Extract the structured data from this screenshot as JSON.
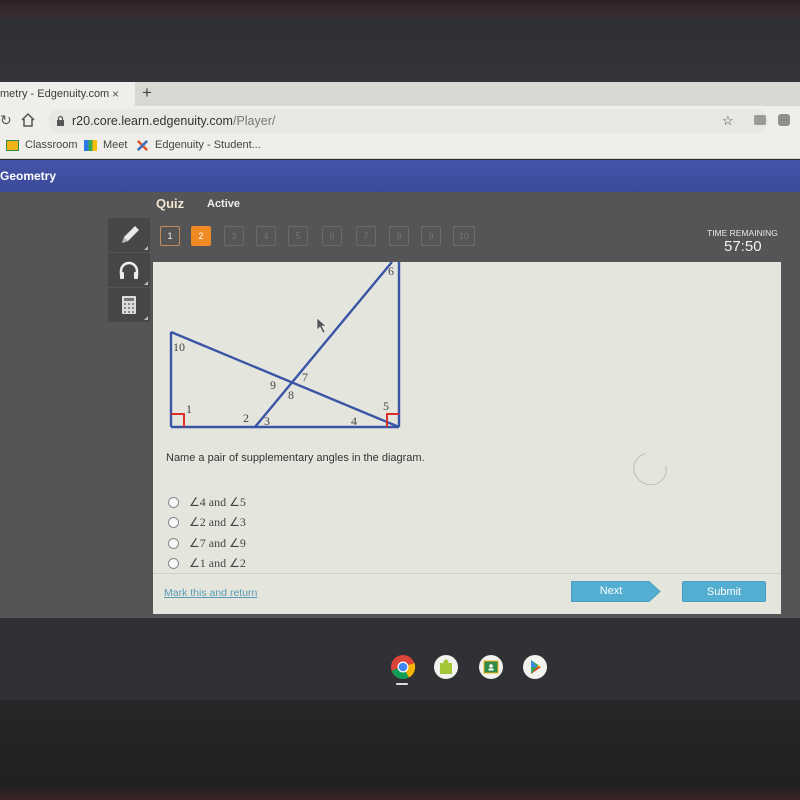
{
  "browser": {
    "tab_title": "metry - Edgenuity.com",
    "tab_close": "×",
    "new_tab": "+",
    "url_host": "r20.core.learn.edgenuity.com",
    "url_path": "/Player/",
    "bookmarks": [
      {
        "label": "Classroom",
        "icon": "google-classroom-icon"
      },
      {
        "label": "Meet",
        "icon": "google-meet-icon"
      },
      {
        "label": "Edgenuity - Student...",
        "icon": "edgenuity-icon"
      }
    ]
  },
  "app": {
    "course_title": "Geometry",
    "quiz_label": "Quiz",
    "status_label": "Active",
    "tools": [
      {
        "name": "pencil-icon"
      },
      {
        "name": "headphones-icon"
      },
      {
        "name": "calculator-icon"
      }
    ],
    "questions": [
      {
        "label": "1",
        "state": "visited"
      },
      {
        "label": "2",
        "state": "current"
      },
      {
        "label": "3",
        "state": "locked"
      },
      {
        "label": "4",
        "state": "locked"
      },
      {
        "label": "5",
        "state": "locked"
      },
      {
        "label": "6",
        "state": "locked"
      },
      {
        "label": "7",
        "state": "locked"
      },
      {
        "label": "8",
        "state": "locked"
      },
      {
        "label": "9",
        "state": "locked"
      },
      {
        "label": "10",
        "state": "locked"
      }
    ],
    "timer": {
      "label": "TIME REMAINING",
      "value": "57:50"
    },
    "accent_color": "#ef8a25",
    "header_color": "#3f4fa0"
  },
  "diagram": {
    "angle_labels": [
      "1",
      "2",
      "3",
      "4",
      "5",
      "6",
      "7",
      "8",
      "9",
      "10"
    ],
    "line_color": "#3a55a6",
    "right_angle_color": "#d9302a"
  },
  "question": {
    "prompt": "Name a pair of supplementary angles in the diagram.",
    "choices": [
      {
        "text": "∠4 and ∠5"
      },
      {
        "text": "∠2 and ∠3"
      },
      {
        "text": "∠7 and ∠9"
      },
      {
        "text": "∠1 and ∠2"
      }
    ]
  },
  "footer": {
    "mark_link": "Mark this and return",
    "next_label": "Next",
    "submit_label": "Submit"
  },
  "shelf": {
    "apps": [
      "chrome-icon",
      "app-store-icon",
      "google-classroom-icon",
      "play-store-icon"
    ]
  }
}
